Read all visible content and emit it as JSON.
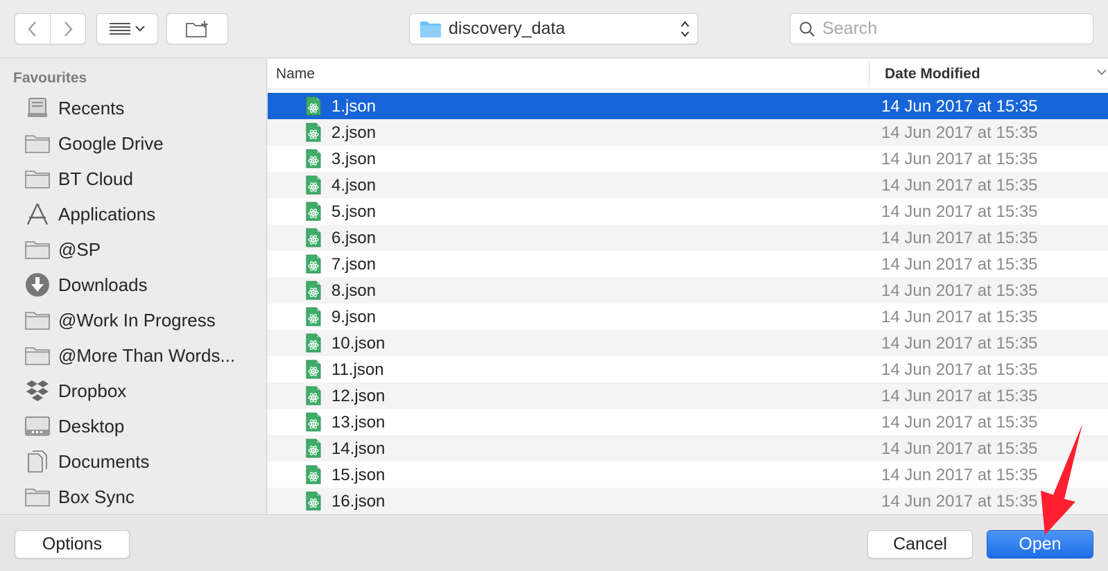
{
  "toolbar": {
    "path_label": "discovery_data",
    "search_placeholder": "Search"
  },
  "sidebar": {
    "heading": "Favourites",
    "items": [
      {
        "label": "Recents",
        "icon": "recents-icon"
      },
      {
        "label": "Google Drive",
        "icon": "folder-icon"
      },
      {
        "label": "BT Cloud",
        "icon": "folder-icon"
      },
      {
        "label": "Applications",
        "icon": "applications-icon"
      },
      {
        "label": "@SP",
        "icon": "folder-icon"
      },
      {
        "label": "Downloads",
        "icon": "downloads-icon"
      },
      {
        "label": "@Work In Progress",
        "icon": "folder-icon"
      },
      {
        "label": "@More Than Words...",
        "icon": "folder-icon"
      },
      {
        "label": "Dropbox",
        "icon": "dropbox-icon"
      },
      {
        "label": "Desktop",
        "icon": "desktop-icon"
      },
      {
        "label": "Documents",
        "icon": "documents-icon"
      },
      {
        "label": "Box Sync",
        "icon": "folder-icon"
      }
    ]
  },
  "filelist": {
    "columns": {
      "name": "Name",
      "date": "Date Modified"
    },
    "selected_index": 0,
    "files": [
      {
        "name": "1.json",
        "date": "14 Jun 2017 at 15:35"
      },
      {
        "name": "2.json",
        "date": "14 Jun 2017 at 15:35"
      },
      {
        "name": "3.json",
        "date": "14 Jun 2017 at 15:35"
      },
      {
        "name": "4.json",
        "date": "14 Jun 2017 at 15:35"
      },
      {
        "name": "5.json",
        "date": "14 Jun 2017 at 15:35"
      },
      {
        "name": "6.json",
        "date": "14 Jun 2017 at 15:35"
      },
      {
        "name": "7.json",
        "date": "14 Jun 2017 at 15:35"
      },
      {
        "name": "8.json",
        "date": "14 Jun 2017 at 15:35"
      },
      {
        "name": "9.json",
        "date": "14 Jun 2017 at 15:35"
      },
      {
        "name": "10.json",
        "date": "14 Jun 2017 at 15:35"
      },
      {
        "name": "11.json",
        "date": "14 Jun 2017 at 15:35"
      },
      {
        "name": "12.json",
        "date": "14 Jun 2017 at 15:35"
      },
      {
        "name": "13.json",
        "date": "14 Jun 2017 at 15:35"
      },
      {
        "name": "14.json",
        "date": "14 Jun 2017 at 15:35"
      },
      {
        "name": "15.json",
        "date": "14 Jun 2017 at 15:35"
      },
      {
        "name": "16.json",
        "date": "14 Jun 2017 at 15:35"
      }
    ]
  },
  "footer": {
    "options_label": "Options",
    "cancel_label": "Cancel",
    "open_label": "Open"
  },
  "colors": {
    "selection": "#1764d8",
    "primary_button": "#2a78ee",
    "annotation_arrow": "#ff1f2f"
  }
}
